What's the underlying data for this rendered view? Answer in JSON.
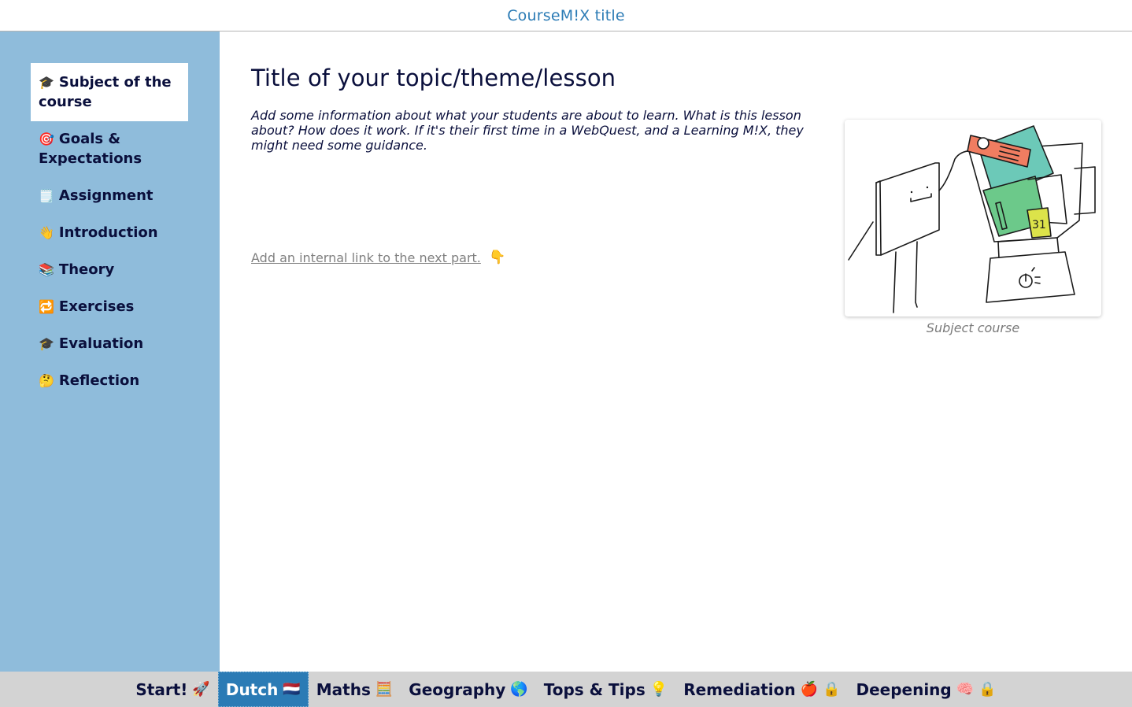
{
  "header": {
    "title": "CourseM!X title"
  },
  "sidebar": {
    "items": [
      {
        "emoji": "🎓",
        "label": "Subject of the course",
        "active": true
      },
      {
        "emoji": "🎯",
        "label": "Goals & Expectations",
        "active": false
      },
      {
        "emoji": "🗒️",
        "label": "Assignment",
        "active": false
      },
      {
        "emoji": "👋",
        "label": "Introduction",
        "active": false
      },
      {
        "emoji": "📚",
        "label": "Theory",
        "active": false
      },
      {
        "emoji": "🔁",
        "label": "Exercises",
        "active": false
      },
      {
        "emoji": "🎓",
        "label": "Evaluation",
        "active": false
      },
      {
        "emoji": "🤔",
        "label": "Reflection",
        "active": false
      }
    ]
  },
  "main": {
    "title": "Title of your topic/theme/lesson",
    "intro": "Add some information about what your students are about to learn. What is this lesson about? How does it work. If it's their first time in a WebQuest, and a Learning M!X, they might need some guidance.",
    "next_link": "Add an internal link to the next part.",
    "next_link_emoji": "👇",
    "figure": {
      "caption": "Subject course",
      "image_icon": "blender-illustration"
    }
  },
  "bottom_nav": {
    "tabs": [
      {
        "label": "Start!",
        "emoji": "🚀",
        "locked": false,
        "active": false
      },
      {
        "label": "Dutch",
        "emoji": "🇳🇱",
        "locked": false,
        "active": true
      },
      {
        "label": "Maths",
        "emoji": "🧮",
        "locked": false,
        "active": false
      },
      {
        "label": "Geography",
        "emoji": "🌎",
        "locked": false,
        "active": false
      },
      {
        "label": "Tops & Tips",
        "emoji": "💡",
        "locked": false,
        "active": false
      },
      {
        "label": "Remediation",
        "emoji": "🍎",
        "locked": true,
        "active": false
      },
      {
        "label": "Deepening",
        "emoji": "🧠",
        "locked": true,
        "active": false
      }
    ],
    "lock_glyph": "🔒"
  },
  "colors": {
    "accent": "#2b7bb5",
    "sidebar_bg": "#8fbcdb",
    "text": "#0a0f3c",
    "nav_bg": "#d3d3d3"
  }
}
